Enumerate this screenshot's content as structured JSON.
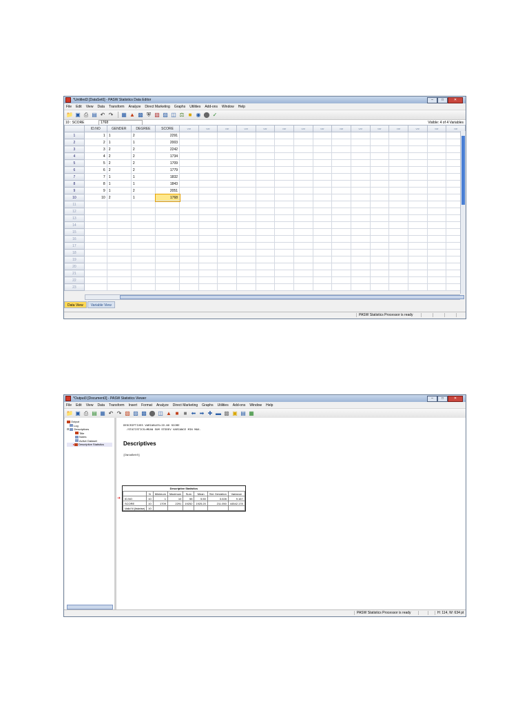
{
  "data_editor": {
    "title": "*Untitled3 [DataSet0] - PASW Statistics Data Editor",
    "menu": [
      "File",
      "Edit",
      "View",
      "Data",
      "Transform",
      "Analyze",
      "Direct Marketing",
      "Graphs",
      "Utilities",
      "Add-ons",
      "Window",
      "Help"
    ],
    "cell_ref": "10 : SCORE",
    "cell_value": "1768",
    "visible_label": "Visible: 4 of 4 Variables",
    "columns": [
      "ID.NO",
      "GENDER",
      "DEGREE",
      "SCORE"
    ],
    "empty_col_label": "var",
    "rows": [
      {
        "n": "1",
        "id": "1",
        "gender": "1",
        "degree": "2",
        "score": "2291"
      },
      {
        "n": "2",
        "id": "2",
        "gender": "1",
        "degree": "1",
        "score": "2003"
      },
      {
        "n": "3",
        "id": "3",
        "gender": "2",
        "degree": "2",
        "score": "2242"
      },
      {
        "n": "4",
        "id": "4",
        "gender": "2",
        "degree": "2",
        "score": "1734"
      },
      {
        "n": "5",
        "id": "5",
        "gender": "2",
        "degree": "2",
        "score": "1709"
      },
      {
        "n": "6",
        "id": "6",
        "gender": "2",
        "degree": "2",
        "score": "1779"
      },
      {
        "n": "7",
        "id": "7",
        "gender": "1",
        "degree": "1",
        "score": "1832"
      },
      {
        "n": "8",
        "id": "8",
        "gender": "1",
        "degree": "1",
        "score": "1843"
      },
      {
        "n": "9",
        "id": "9",
        "gender": "1",
        "degree": "2",
        "score": "2051"
      },
      {
        "n": "10",
        "id": "10",
        "gender": "2",
        "degree": "1",
        "score": "1768"
      }
    ],
    "empty_row_numbers": [
      "11",
      "12",
      "13",
      "14",
      "15",
      "16",
      "17",
      "18",
      "19",
      "20",
      "21",
      "22",
      "23"
    ],
    "tabs": [
      "Data View",
      "Variable View"
    ],
    "status": "PASW Statistics Processor is ready"
  },
  "viewer": {
    "title": "*Output3 [Document3] - PASW Statistics Viewer",
    "menu": [
      "File",
      "Edit",
      "View",
      "Data",
      "Transform",
      "Insert",
      "Format",
      "Analyze",
      "Direct Marketing",
      "Graphs",
      "Utilities",
      "Add-ons",
      "Window",
      "Help"
    ],
    "tree": [
      "Output",
      "Log",
      "Descriptives",
      "Title",
      "Notes",
      "Active Dataset",
      "Descriptive Statistics"
    ],
    "syntax_line1": "DESCRIPTIVES VARIABLES=ID.NO SCORE",
    "syntax_line2": "  /STATISTICS=MEAN SUM STDDEV VARIANCE MIN MAX.",
    "heading": "Descriptives",
    "dataset_ref": "[DataSet0]",
    "table_caption": "Descriptive Statistics",
    "table_headers": [
      "",
      "N",
      "Minimum",
      "Maximum",
      "Sum",
      "Mean",
      "Std. Deviation",
      "Variance"
    ],
    "table_rows": [
      [
        "ID.NO",
        "10",
        "1",
        "10",
        "55",
        "5.50",
        "3.028",
        "9.167"
      ],
      [
        "SCORE",
        "10",
        "1709",
        "2291",
        "19252",
        "1925.20",
        "211.050",
        "44542.178"
      ],
      [
        "Valid N (listwise)",
        "10",
        "",
        "",
        "",
        "",
        "",
        ""
      ]
    ],
    "status": "PASW Statistics Processor is ready",
    "status_dims": "H: 114, W: 634 pt"
  }
}
